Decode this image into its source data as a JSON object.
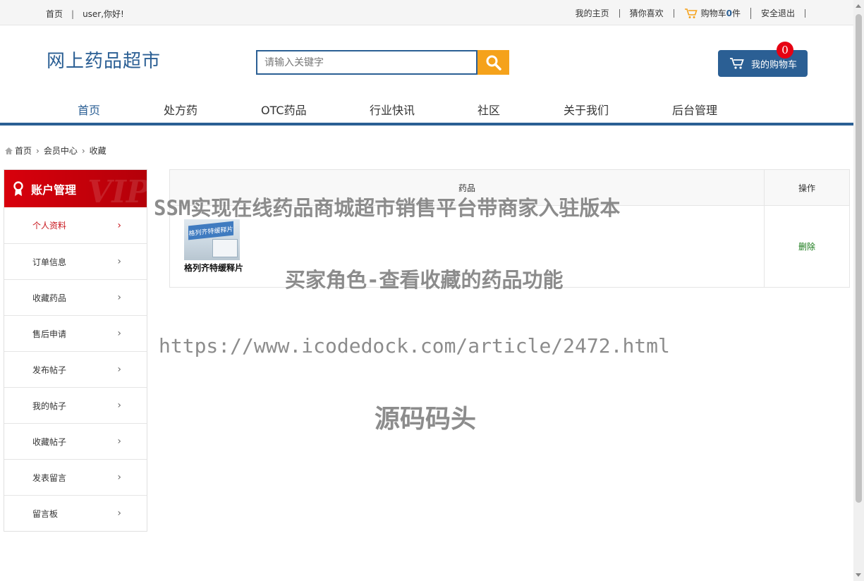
{
  "topbar": {
    "home": "首页",
    "greeting": "user,你好!",
    "links": [
      "我的主页",
      "猜你喜欢",
      "购物车",
      "安全退出"
    ],
    "cart_count": "0",
    "cart_suffix": "件"
  },
  "header": {
    "logo": "网上药品超市",
    "search_placeholder": "请输入关键字",
    "mycart_label": "我的购物车",
    "mycart_badge": "0"
  },
  "nav": [
    "首页",
    "处方药",
    "OTC药品",
    "行业快讯",
    "社区",
    "关于我们",
    "后台管理"
  ],
  "breadcrumb": [
    "首页",
    "会员中心",
    "收藏"
  ],
  "sidebar": {
    "title": "账户管理",
    "vip": "VIP",
    "items": [
      "个人资料",
      "订单信息",
      "收藏药品",
      "售后申请",
      "发布帖子",
      "我的帖子",
      "收藏帖子",
      "发表留言",
      "留言板"
    ]
  },
  "table": {
    "headers": [
      "药品",
      "操作"
    ],
    "rows": [
      {
        "name": "格列齐特缓释片",
        "thumb_text": "格列齐特缓释片",
        "action": "删除"
      }
    ]
  },
  "watermark": {
    "line1": "SSM实现在线药品商城超市销售平台带商家入驻版本",
    "line2": "买家角色-查看收藏的药品功能",
    "line3": "https://www.icodedock.com/article/2472.html",
    "line4": "源码码头"
  }
}
